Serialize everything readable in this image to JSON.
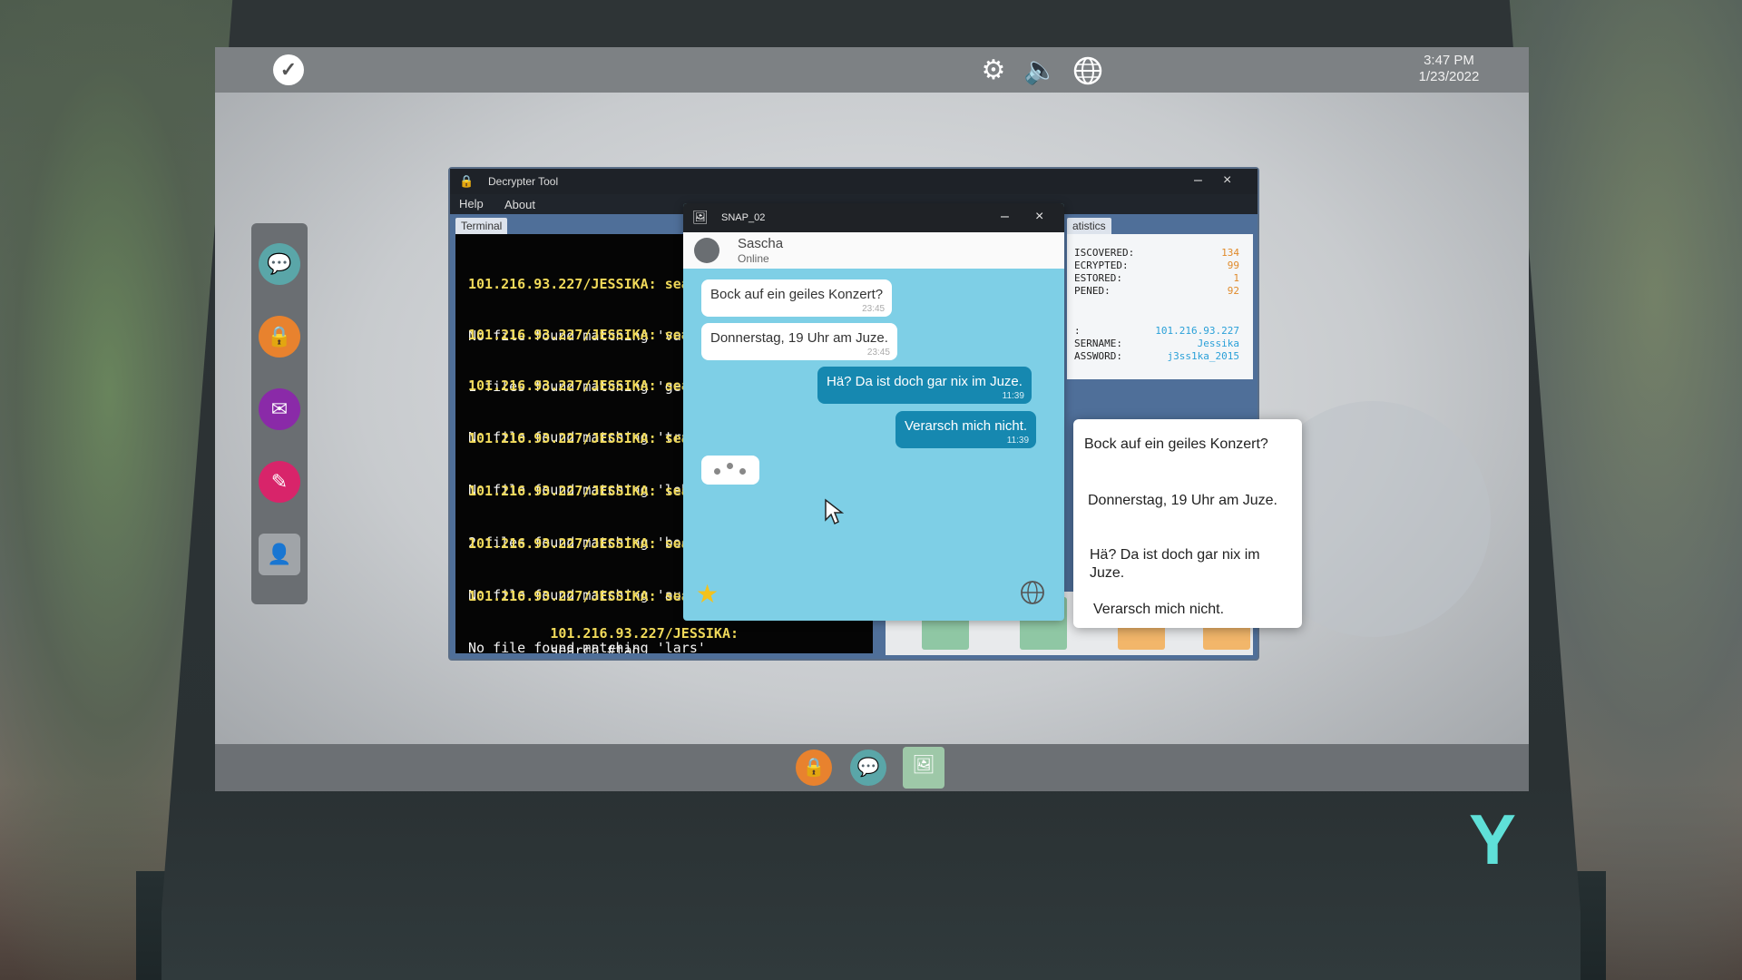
{
  "topbar": {
    "time": "3:47 PM",
    "date": "1/23/2022"
  },
  "decrypter": {
    "title": "Decrypter Tool",
    "menu": [
      "Help",
      "About"
    ],
    "tabs": {
      "terminal": "Terminal",
      "statistics": "atistics"
    },
    "terminal_lines": [
      {
        "prompt": "101.216.93.227/JESSIKA: sea",
        "result": "No file found matching 'vater"
      },
      {
        "prompt": "101.216.93.227/JESSIKA: sea",
        "result": "1 files found matching 'germa"
      },
      {
        "prompt": "101.216.93.227/JESSIKA: sea",
        "result": "No file found matching 'trait"
      },
      {
        "prompt": "101.216.93.227/JESSIKA: sea",
        "result": "No file found matching 'leben"
      },
      {
        "prompt": "101.216.93.227/JESSIKA: sea",
        "result": "2 files found matching 'bock'"
      },
      {
        "prompt": "101.216.93.227/JESSIKA: sea",
        "result": "No file found matching 'ausbi"
      },
      {
        "prompt": "101.216.93.227/JESSIKA: sea",
        "result": "No file found matching 'lars'"
      }
    ],
    "terminal_current": {
      "prompt": "101.216.93.227/JESSIKA:",
      "input": "search #tag"
    },
    "stats": [
      {
        "label": "ISCOVERED:",
        "value": "134"
      },
      {
        "label": "ECRYPTED:",
        "value": "99"
      },
      {
        "label": "ESTORED:",
        "value": "1"
      },
      {
        "label": "PENED:",
        "value": "92"
      }
    ],
    "account": [
      {
        "label": ":",
        "value": "101.216.93.227"
      },
      {
        "label": "SERNAME:",
        "value": "Jessika"
      },
      {
        "label": "ASSWORD:",
        "value": "j3ss1ka_2015"
      }
    ]
  },
  "chat": {
    "title": "SNAP_02",
    "contact_name": "Sascha",
    "contact_status": "Online",
    "messages": [
      {
        "text": "Bock auf ein geiles Konzert?",
        "time": "23:45",
        "dir": "in"
      },
      {
        "text": "Donnerstag, 19 Uhr am Juze.",
        "time": "23:45",
        "dir": "in"
      },
      {
        "text": "Hä? Da ist doch gar nix im Juze.",
        "time": "11:39",
        "dir": "out"
      },
      {
        "text": "Verarsch mich nicht.",
        "time": "11:39",
        "dir": "out"
      }
    ]
  },
  "popup": {
    "options": [
      "Bock auf ein geiles Konzert?",
      "Donnerstag, 19 Uhr am Juze.",
      "Hä? Da ist doch gar nix im Juze.",
      "Verarsch mich nicht."
    ]
  },
  "colors": {
    "accent_teal": "#5fe0d8",
    "chat_bg": "#7ecfe6",
    "bubble_out": "#1688b0",
    "terminal_prompt": "#f1da5a",
    "stat_value": "#e08a2a",
    "account_value": "#2aa0d8"
  },
  "icons": {
    "os_logo": "y-logo-icon",
    "settings": "gear-icon",
    "sound": "speaker-icon",
    "network": "globe-icon",
    "dock": [
      "chat-icon",
      "lock-icon",
      "mail-icon",
      "notes-icon",
      "contact-icon"
    ],
    "taskbar": [
      "lock-icon",
      "chat-icon",
      "image-file-icon"
    ]
  }
}
